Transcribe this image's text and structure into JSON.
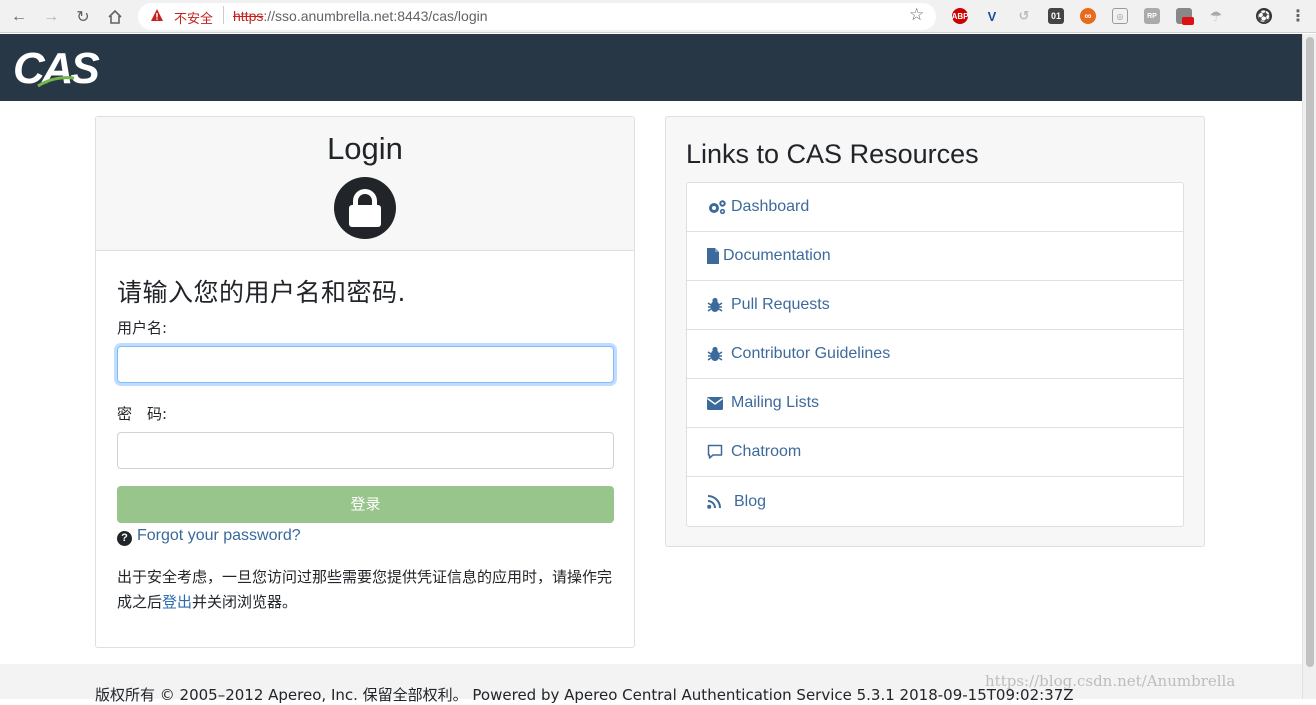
{
  "browser": {
    "security_label": "不安全",
    "url_scheme": "https",
    "url_rest": "://sso.anumbrella.net:8443/cas/login",
    "extensions": [
      "ABP",
      "V",
      "",
      "01",
      "",
      "",
      "RP",
      "",
      "",
      ""
    ]
  },
  "header": {
    "logo_text": "CAS"
  },
  "login": {
    "title": "Login",
    "prompt": "请输入您的用户名和密码.",
    "username_label": "用户名:",
    "password_label": "密　码:",
    "submit_label": "登录",
    "forgot_label": "Forgot your password?",
    "note_before": "出于安全考虑，一旦您访问过那些需要您提供凭证信息的应用时，请操作完成之后",
    "note_link": "登出",
    "note_after": "并关闭浏览器。"
  },
  "links": {
    "title": "Links to CAS Resources",
    "items": [
      {
        "label": "Dashboard",
        "icon": "cogs-icon"
      },
      {
        "label": "Documentation",
        "icon": "file-icon"
      },
      {
        "label": "Pull Requests",
        "icon": "bug-icon"
      },
      {
        "label": "Contributor Guidelines",
        "icon": "bug-icon"
      },
      {
        "label": "Mailing Lists",
        "icon": "envelope-icon"
      },
      {
        "label": "Chatroom",
        "icon": "comment-icon"
      },
      {
        "label": "Blog",
        "icon": "rss-icon"
      }
    ]
  },
  "footer": {
    "text": "版权所有 © 2005–2012 Apereo, Inc. 保留全部权利。 Powered by Apereo Central Authentication Service 5.3.1 2018-09-15T09:02:37Z"
  },
  "watermark": "https://blog.csdn.net/Anumbrella"
}
